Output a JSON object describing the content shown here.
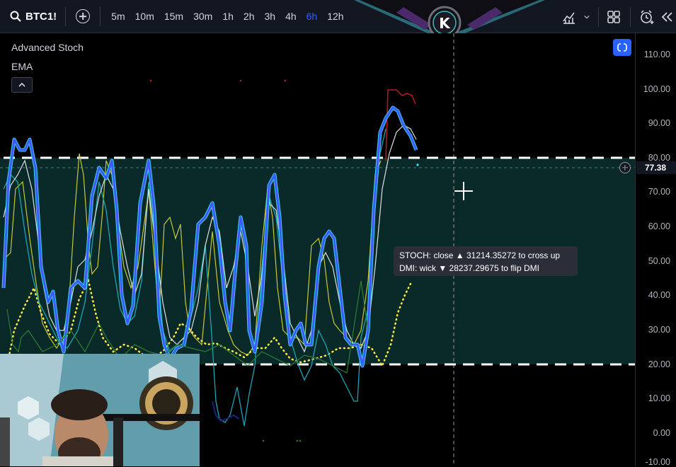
{
  "toolbar": {
    "symbol": "BTC1!",
    "intervals": [
      "5m",
      "10m",
      "15m",
      "30m",
      "1h",
      "2h",
      "3h",
      "4h",
      "6h",
      "12h"
    ],
    "active_interval": "6h"
  },
  "banner": {
    "logo_letter": "K"
  },
  "legend": {
    "indicator_name": "Advanced Stoch",
    "overlay_name": "EMA"
  },
  "price_scale": {
    "ticks": [
      "110.00",
      "100.00",
      "90.00",
      "80.00",
      "70.00",
      "60.00",
      "50.00",
      "40.00",
      "30.00",
      "20.00",
      "10.00",
      "0.00",
      "-10.00"
    ],
    "current_value": "77.38"
  },
  "tooltip": {
    "line1": "STOCH: close ▲ 31214.35272 to cross up",
    "line2": "DMI: wick ▼ 28237.29675 to flip DMI"
  },
  "colors": {
    "active_interval": "#2962ff",
    "fill_zone": "#0a2a2a",
    "stoch_k": "#3d5afe",
    "stoch_glow": "#40e0ff",
    "stoch_d": "#ffffff",
    "yellow_line": "#c8c832",
    "dotted_yellow": "#ffeb3b",
    "red_line": "#b71c1c"
  }
}
